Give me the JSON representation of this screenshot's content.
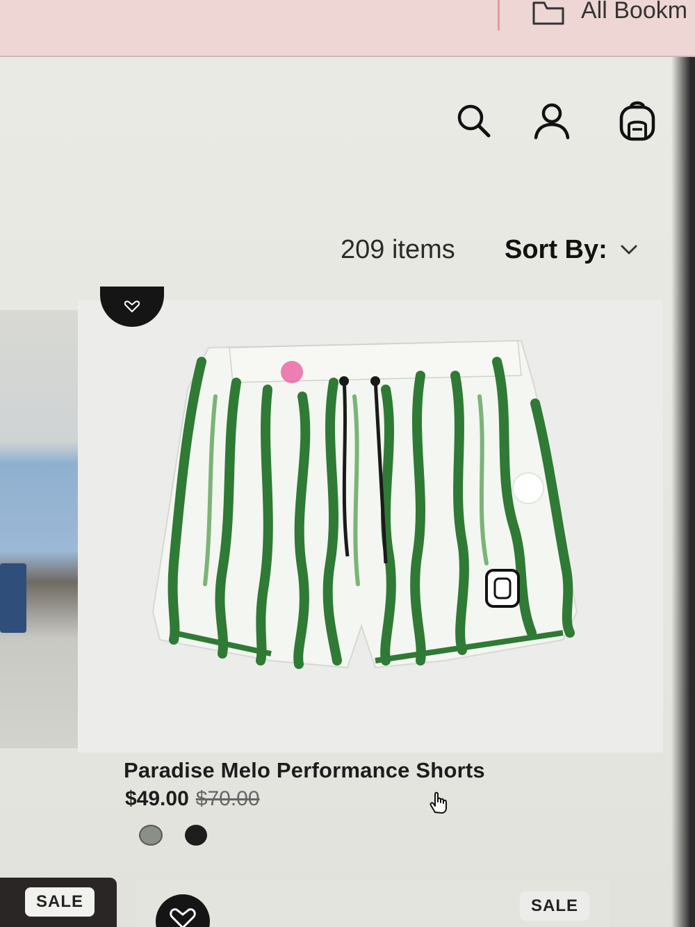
{
  "browser": {
    "bookmarks_label": "All Bookm"
  },
  "header": {
    "icons": [
      "search-icon",
      "account-icon",
      "shopping-bag-icon"
    ]
  },
  "listing": {
    "item_count": "209 items",
    "sort_label": "Sort By:"
  },
  "product": {
    "title": "Paradise Melo Performance Shorts",
    "sale_price": "$49.00",
    "original_price": "$70.00",
    "swatches": [
      "green-stripe",
      "black"
    ]
  },
  "next_row": {
    "badge_left": "SALE",
    "badge_right": "SALE"
  },
  "colors": {
    "accent_dark": "#151515",
    "stripe_green": "#2f7a35",
    "bookmarks_bar": "#eed6d4"
  }
}
